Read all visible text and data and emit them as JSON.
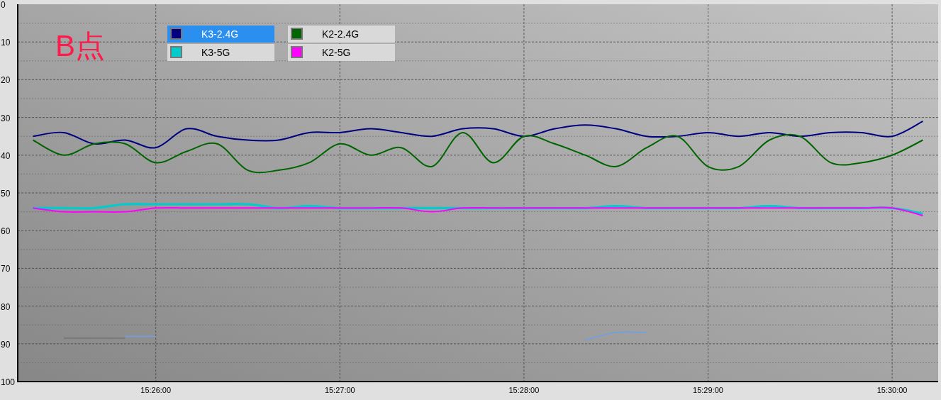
{
  "annotation": "B点",
  "legend": [
    {
      "selected": true
    },
    {
      "selected": false
    },
    {
      "selected": false
    },
    {
      "selected": false
    }
  ],
  "chart_data": {
    "type": "line",
    "grid": true,
    "legend": true,
    "ylim": [
      100,
      0
    ],
    "categories": [
      null,
      null,
      null,
      null,
      "15:26:00",
      null,
      null,
      null,
      null,
      null,
      "15:27:00",
      null,
      null,
      null,
      null,
      null,
      "15:28:00",
      null,
      null,
      null,
      null,
      null,
      "15:29:00",
      null,
      null,
      null,
      null,
      null,
      "15:30:00",
      null
    ],
    "yticks": [
      0,
      10,
      20,
      30,
      40,
      50,
      60,
      70,
      80,
      90,
      100
    ],
    "series": [
      {
        "name": "K3-2.4G",
        "color": "#000080",
        "values": [
          35,
          34,
          37,
          36,
          38,
          33,
          35,
          36,
          36,
          34,
          34,
          33,
          34,
          35,
          33,
          33,
          35,
          33,
          32,
          33,
          35,
          35,
          34,
          35,
          34,
          35,
          34,
          34,
          35,
          31
        ]
      },
      {
        "name": "K3-5G",
        "color": "#00cccc",
        "values": [
          54,
          54,
          54,
          53,
          53,
          53,
          53,
          53,
          54,
          53.5,
          54,
          54,
          54,
          54,
          54,
          54,
          54,
          54,
          54,
          53.5,
          54,
          54,
          54,
          54,
          53.5,
          54,
          54,
          54,
          54,
          55.5
        ]
      },
      {
        "name": "K2-2.4G",
        "color": "#006400",
        "values": [
          36,
          40,
          37,
          37,
          42,
          39,
          37,
          44,
          44,
          42,
          37,
          40,
          38,
          43,
          34,
          42,
          35,
          37,
          40,
          43,
          38,
          35,
          43,
          43,
          36,
          35,
          42,
          42,
          40,
          36
        ]
      },
      {
        "name": "K2-5G",
        "color": "#ff00ff",
        "values": [
          54,
          55,
          55,
          55,
          54,
          54,
          54,
          54,
          54,
          54,
          54,
          54,
          54,
          55,
          54,
          54,
          54,
          54,
          54,
          54,
          54,
          54,
          54,
          54,
          54,
          54,
          54,
          54,
          54,
          56
        ]
      },
      {
        "color": "#6e6e6e",
        "values": [
          null,
          88.5,
          88.5,
          88.5,
          null,
          null,
          null,
          null,
          null,
          null,
          null,
          null,
          null,
          null,
          null,
          null,
          null,
          null,
          null,
          null,
          null,
          null,
          null,
          null,
          null,
          null,
          null,
          null,
          null,
          null
        ]
      },
      {
        "color": "#6f9fe6",
        "values": [
          null,
          null,
          null,
          88,
          88,
          null,
          null,
          null,
          null,
          null,
          null,
          null,
          null,
          null,
          null,
          null,
          null,
          null,
          89,
          87,
          87,
          null,
          null,
          null,
          null,
          null,
          null,
          null,
          null,
          null
        ]
      }
    ]
  }
}
